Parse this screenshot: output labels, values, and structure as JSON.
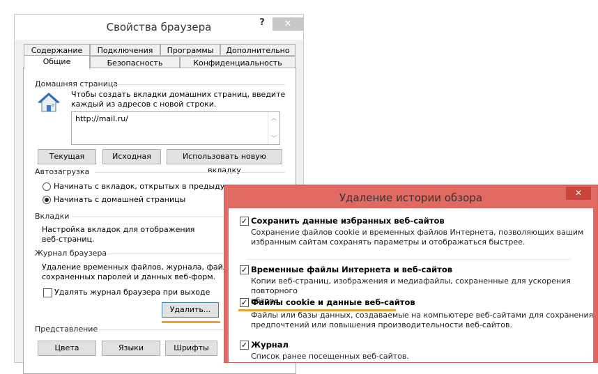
{
  "options": {
    "title": "Свойства браузера",
    "help": "?",
    "close": "✕",
    "tabs_top": [
      "Содержание",
      "Подключения",
      "Программы",
      "Дополнительно"
    ],
    "tabs_bottom": [
      "Общие",
      "Безопасность",
      "Конфиденциальность"
    ],
    "home": {
      "group": "Домашняя страница",
      "desc_line1": "Чтобы создать вкладки домашних страниц, введите",
      "desc_line2": "каждый из адресов с новой строки.",
      "url": "http://mail.ru/",
      "btn_current": "Текущая",
      "btn_default": "Исходная",
      "btn_newtab": "Использовать новую вкладку"
    },
    "startup": {
      "group": "Автозагрузка",
      "radio1": "Начинать с вкладок, открытых в предыдущем сеансе",
      "radio2": "Начинать с домашней страницы"
    },
    "tabsgroup": {
      "group": "Вкладки",
      "desc_line1": "Настройка вкладок для отображения",
      "desc_line2": "веб-страниц."
    },
    "history": {
      "group": "Журнал браузера",
      "desc_line1": "Удаление временных файлов, журнала, файлов cookie,",
      "desc_line2": "сохраненных паролей и данных веб-форм.",
      "checkbox": "Удалять журнал браузера при выходе",
      "delete_btn": "Удалить..."
    },
    "view": {
      "group": "Представление",
      "btn_colors": "Цвета",
      "btn_languages": "Языки",
      "btn_fonts": "Шрифты"
    }
  },
  "delete_dialog": {
    "title": "Удаление истории обзора",
    "close": "✕",
    "items": [
      {
        "title": "Сохранить данные избранных веб-сайтов",
        "desc_line1": "Сохранение файлов cookie и временных файлов Интернета, позволяющих вашим",
        "desc_line2": "избранным сайтам сохранять параметры и отображаться быстрее.",
        "checked": true
      },
      {
        "title": "Временные файлы Интернета и веб-сайтов",
        "desc_line1": "Копии веб-страниц, изображения и медиафайлы, сохраненные для ускорения повторного",
        "desc_line2": "обзора.",
        "checked": true
      },
      {
        "title": "Файлы cookie и данные веб-сайтов",
        "desc_line1": "Файлы или базы данных, создаваемые на компьютере веб-сайтами для сохранения",
        "desc_line2": "предпочтений или повышения производительности веб-сайтов.",
        "checked": true
      },
      {
        "title": "Журнал",
        "desc_line1": "Список ранее посещенных веб-сайтов.",
        "checked": true
      }
    ]
  },
  "colors": {
    "accent_highlight": "#f0a030",
    "dialog_frame": "#e06a61"
  }
}
